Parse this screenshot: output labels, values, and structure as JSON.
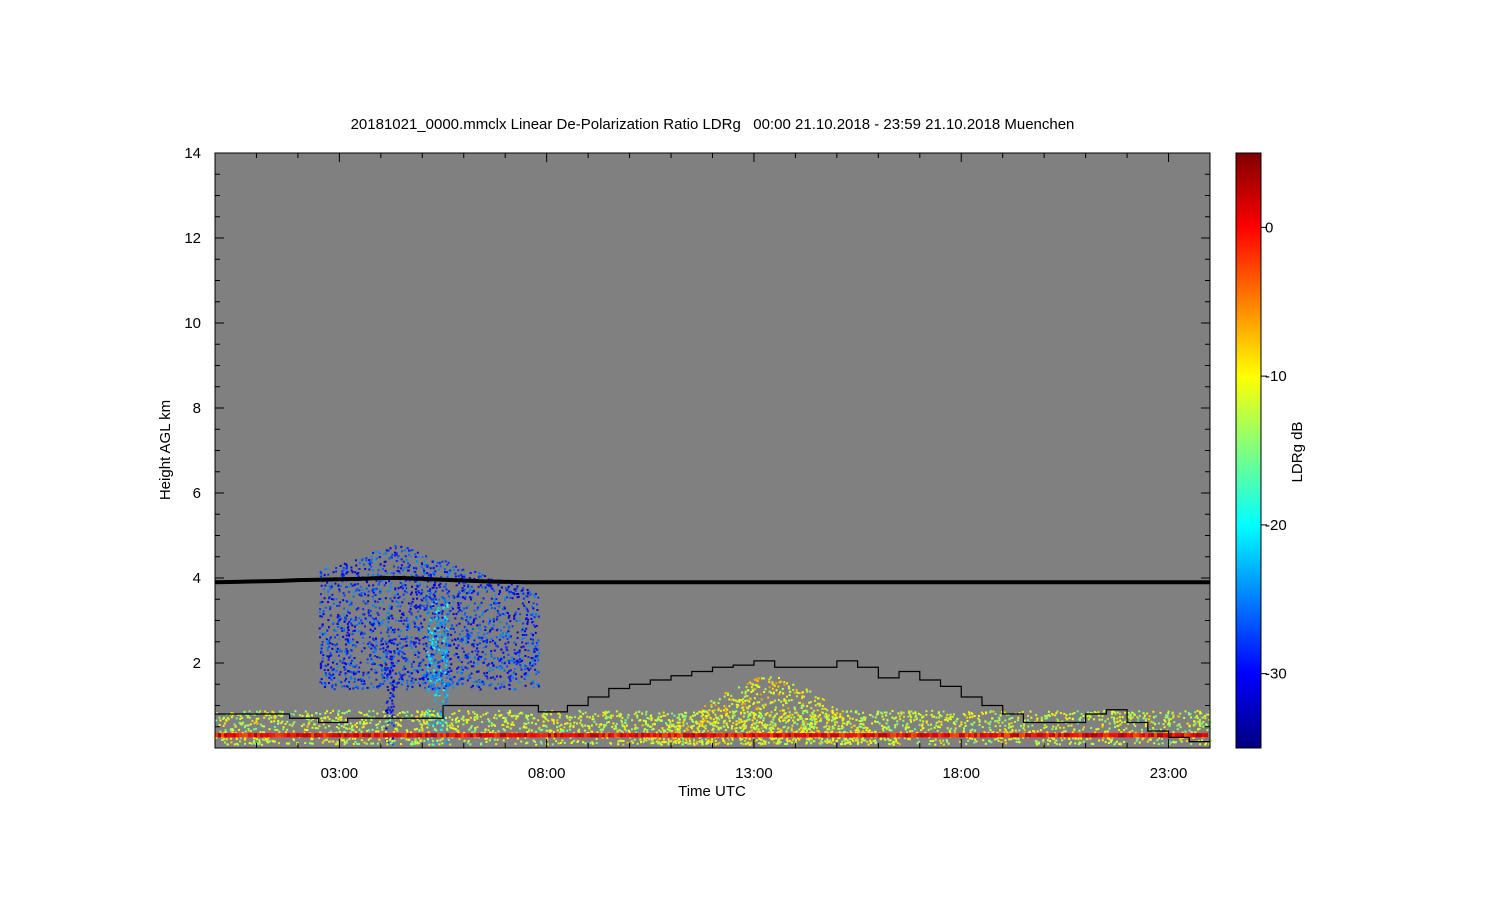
{
  "chart_data": {
    "type": "heatmap",
    "title": "20181021_0000.mmclx Linear De-Polarization Ratio LDRg   00:00 21.10.2018 - 23:59 21.10.2018 Muenchen",
    "xlabel": "Time UTC",
    "ylabel": "Height AGL km",
    "colorbar_label": "LDRg dB",
    "xlim": [
      0,
      24
    ],
    "ylim": [
      0,
      14
    ],
    "x_ticks": [
      {
        "value": 3,
        "label": "03:00"
      },
      {
        "value": 8,
        "label": "08:00"
      },
      {
        "value": 13,
        "label": "13:00"
      },
      {
        "value": 18,
        "label": "18:00"
      },
      {
        "value": 23,
        "label": "23:00"
      }
    ],
    "y_ticks": [
      {
        "value": 2,
        "label": "2"
      },
      {
        "value": 4,
        "label": "4"
      },
      {
        "value": 6,
        "label": "6"
      },
      {
        "value": 8,
        "label": "8"
      },
      {
        "value": 10,
        "label": "10"
      },
      {
        "value": 12,
        "label": "12"
      },
      {
        "value": 14,
        "label": "14"
      }
    ],
    "colorbar_range": [
      -35,
      5
    ],
    "colorbar_ticks": [
      {
        "value": 0,
        "label": "0"
      },
      {
        "value": -10,
        "label": "-10"
      },
      {
        "value": -20,
        "label": "-20"
      },
      {
        "value": -30,
        "label": "-30"
      }
    ],
    "background_color": "#808080",
    "colormap": [
      "#00007f",
      "#0000ff",
      "#007fff",
      "#00ffff",
      "#7fff7f",
      "#ffff00",
      "#ff7f00",
      "#ff0000",
      "#7f0000"
    ],
    "series": [
      {
        "type": "line",
        "color": "#000000",
        "x": [
          0,
          0.5,
          1,
          1.5,
          2,
          2.5,
          3,
          3.5,
          4,
          4.5,
          5,
          5.5,
          6,
          6.5,
          7,
          7.5,
          8,
          8.5,
          9,
          9.5,
          10,
          10.5,
          11,
          11.5,
          12,
          12.5,
          13,
          13.5,
          14,
          14.5,
          15,
          15.5,
          16,
          16.5,
          17,
          17.5,
          18,
          18.5,
          19,
          19.5,
          20,
          20.5,
          21,
          21.5,
          22,
          22.5,
          23,
          23.5,
          24
        ],
        "y": [
          3.9,
          3.91,
          3.92,
          3.93,
          3.95,
          3.96,
          3.97,
          3.98,
          4.0,
          4.0,
          3.98,
          3.96,
          3.94,
          3.92,
          3.91,
          3.9,
          3.9,
          3.9,
          3.9,
          3.9,
          3.9,
          3.9,
          3.9,
          3.9,
          3.9,
          3.9,
          3.9,
          3.9,
          3.9,
          3.9,
          3.9,
          3.9,
          3.9,
          3.9,
          3.9,
          3.9,
          3.9,
          3.9,
          3.9,
          3.9,
          3.9,
          3.9,
          3.9,
          3.9,
          3.9,
          3.9,
          3.9,
          3.9,
          3.9
        ]
      },
      {
        "type": "step",
        "color": "#000000",
        "x": [
          0,
          1.2,
          1.8,
          2.5,
          3.2,
          4.3,
          5.5,
          6.5,
          7.5,
          7.8,
          8.5,
          9,
          9.5,
          10,
          10.5,
          11,
          11.5,
          12,
          12.5,
          13,
          13.5,
          14,
          14.5,
          15,
          15.5,
          16,
          16.5,
          17,
          17.5,
          18,
          18.5,
          19,
          19.5,
          20,
          20.5,
          21,
          21.5,
          22,
          22.5,
          23,
          23.5,
          24
        ],
        "y": [
          0.8,
          0.8,
          0.7,
          0.6,
          0.7,
          0.7,
          1.0,
          1.0,
          1.0,
          0.85,
          1.0,
          1.2,
          1.4,
          1.5,
          1.6,
          1.7,
          1.8,
          1.9,
          1.95,
          2.05,
          1.9,
          1.9,
          1.9,
          2.05,
          1.9,
          1.65,
          1.8,
          1.6,
          1.45,
          1.2,
          1.0,
          0.8,
          0.6,
          0.6,
          0.6,
          0.8,
          0.9,
          0.6,
          0.4,
          0.25,
          0.15,
          0.15
        ]
      }
    ],
    "regions": [
      {
        "type": "cloud",
        "x": [
          2.5,
          7.8
        ],
        "y": [
          1.4,
          5.0
        ],
        "ldr_db": -28
      },
      {
        "type": "fall_streak",
        "x": [
          5.1,
          5.6
        ],
        "y": [
          0.1,
          3.5
        ],
        "ldr_db": -22
      },
      {
        "type": "fall_streak",
        "x": [
          4.1,
          4.3
        ],
        "y": [
          0.1,
          3.2
        ],
        "ldr_db": -30
      },
      {
        "type": "echo",
        "x": [
          9.5,
          16.5
        ],
        "y": [
          0.1,
          1.7
        ],
        "ldr_db": -10
      },
      {
        "type": "ground_layer",
        "x": [
          0,
          24
        ],
        "y": [
          0.1,
          0.9
        ],
        "ldr_db": -12
      },
      {
        "type": "ground_line",
        "x": [
          0,
          24
        ],
        "y": [
          0.25,
          0.35
        ],
        "ldr_db": 0
      }
    ]
  }
}
